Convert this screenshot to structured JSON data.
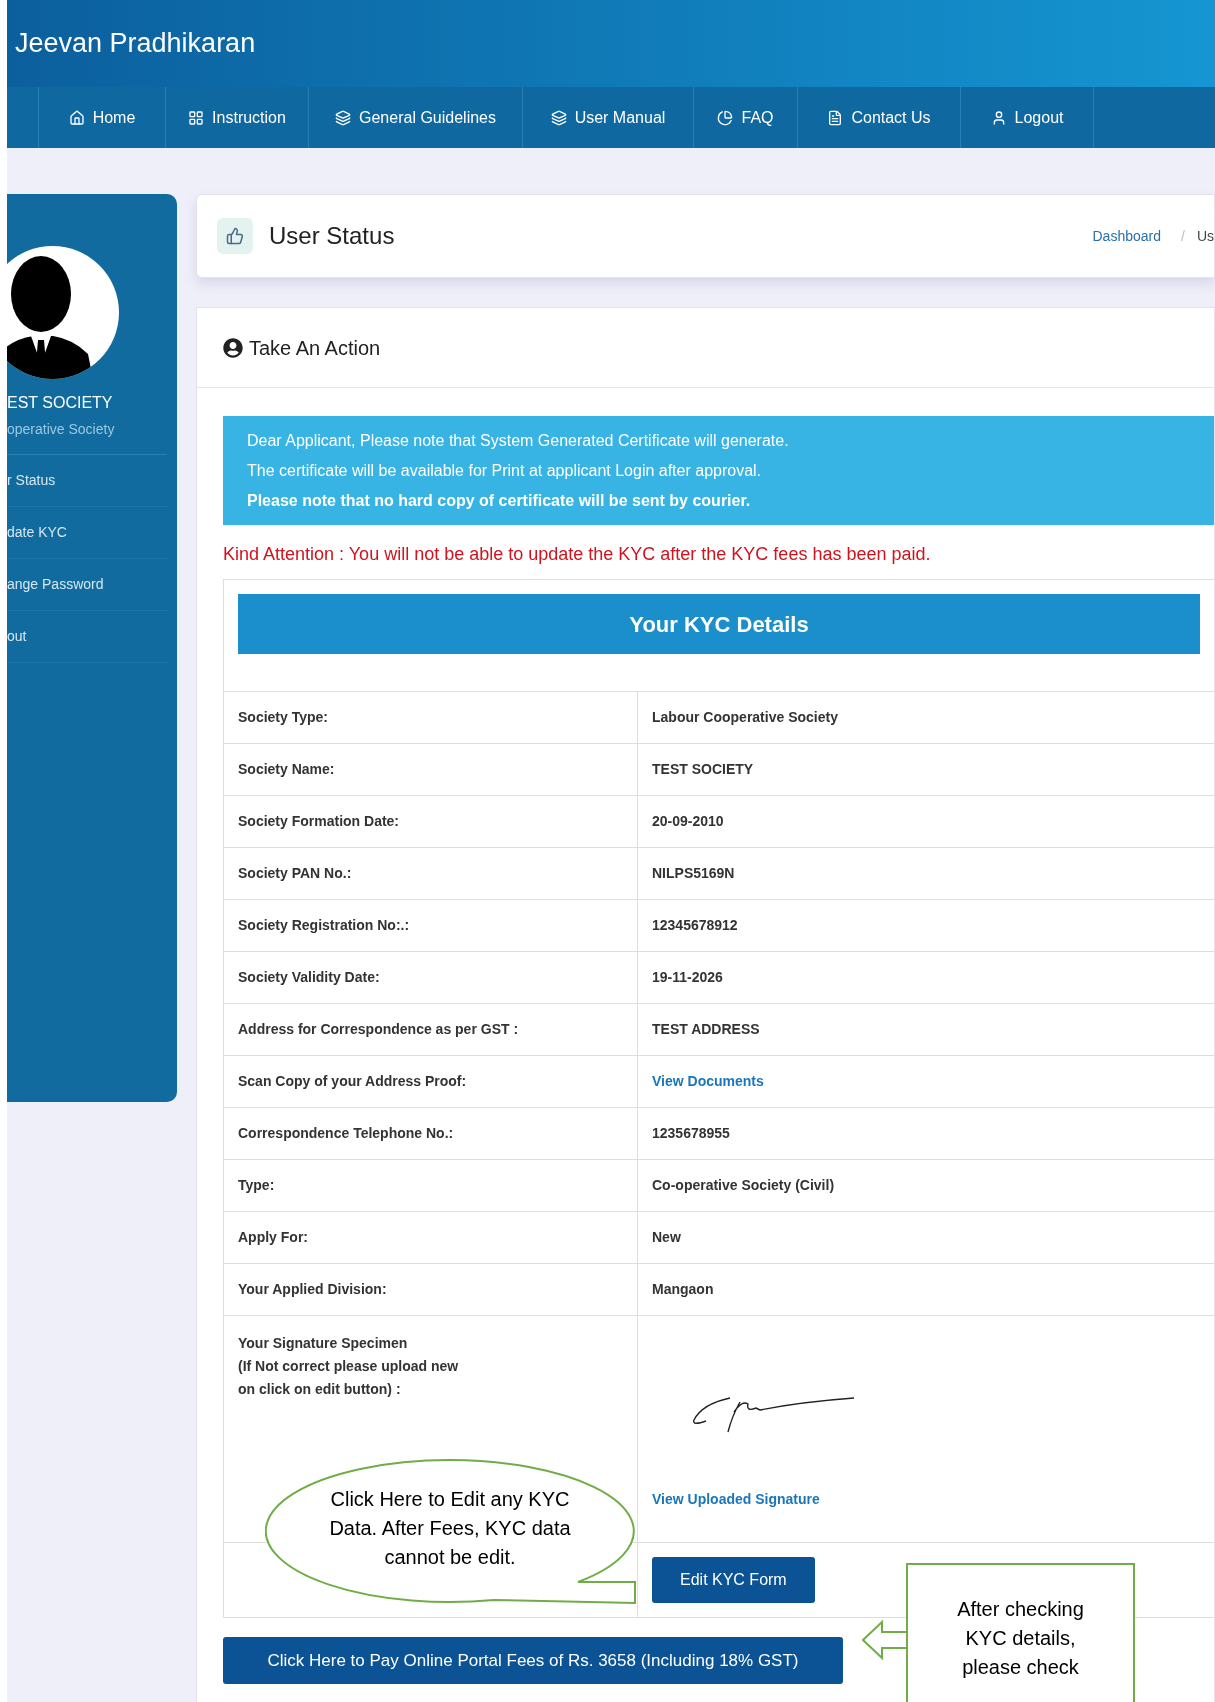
{
  "header": {
    "title": "Jeevan Pradhikaran"
  },
  "nav": [
    {
      "label": "Home"
    },
    {
      "label": "Instruction"
    },
    {
      "label": "General Guidelines"
    },
    {
      "label": "User Manual"
    },
    {
      "label": "FAQ"
    },
    {
      "label": "Contact Us"
    },
    {
      "label": "Logout"
    }
  ],
  "sidebar": {
    "name": "EST SOCIETY",
    "subtitle": "operative Society",
    "items": [
      "r Status",
      "date KYC",
      "ange Password",
      "out"
    ]
  },
  "page_header": {
    "title": "User Status",
    "breadcrumb": [
      "Dashboard",
      "Us"
    ],
    "separator": "/"
  },
  "card": {
    "title": "Take An Action",
    "notice": [
      {
        "text": "Dear Applicant, Please note that System Generated Certificate will generate.",
        "bold": false
      },
      {
        "text": "The certificate will be available for Print at applicant Login after approval.",
        "bold": false
      },
      {
        "text": "Please note that no hard copy of certificate will be sent by courier.",
        "bold": true
      }
    ],
    "attention": "Kind Attention : You will not be able to update the KYC after the KYC fees has been paid.",
    "kyc": {
      "title": "Your KYC Details",
      "rows": [
        {
          "kind": "text",
          "label": "Society Type:",
          "value": "Labour Cooperative Society"
        },
        {
          "kind": "text",
          "label": "Society Name:",
          "value": "TEST SOCIETY"
        },
        {
          "kind": "text",
          "label": "Society Formation Date:",
          "value": "20-09-2010"
        },
        {
          "kind": "text",
          "label": "Society PAN No.:",
          "value": "NILPS5169N"
        },
        {
          "kind": "text",
          "label": "Society Registration No:.:",
          "value": "12345678912"
        },
        {
          "kind": "text",
          "label": "Society Validity Date:",
          "value": "19-11-2026"
        },
        {
          "kind": "text",
          "label": "Address for Correspondence as per GST :",
          "value": "TEST ADDRESS"
        },
        {
          "kind": "link",
          "label": "Scan Copy of your Address Proof:",
          "value": "View Documents"
        },
        {
          "kind": "text",
          "label": "Correspondence Telephone No.:",
          "value": "1235678955"
        },
        {
          "kind": "text",
          "label": "Type:",
          "value": "Co-operative Society (Civil)"
        },
        {
          "kind": "text",
          "label": "Apply For:",
          "value": "New"
        },
        {
          "kind": "text",
          "label": "Your Applied Division:",
          "value": "Mangaon"
        },
        {
          "kind": "signature",
          "label": "Your Signature Specimen\n(If Not correct please upload new\non click on edit button) :",
          "value": "View Uploaded Signature"
        }
      ],
      "edit_button": "Edit KYC Form"
    },
    "pay_button": "Click Here to Pay Online Portal Fees of Rs. 3658 (Including 18% GST)"
  },
  "callouts": {
    "edit_note": "Click Here to Edit any KYC Data. After Fees, KYC data cannot be edit.",
    "check_note": "After checking KYC details, please check"
  }
}
